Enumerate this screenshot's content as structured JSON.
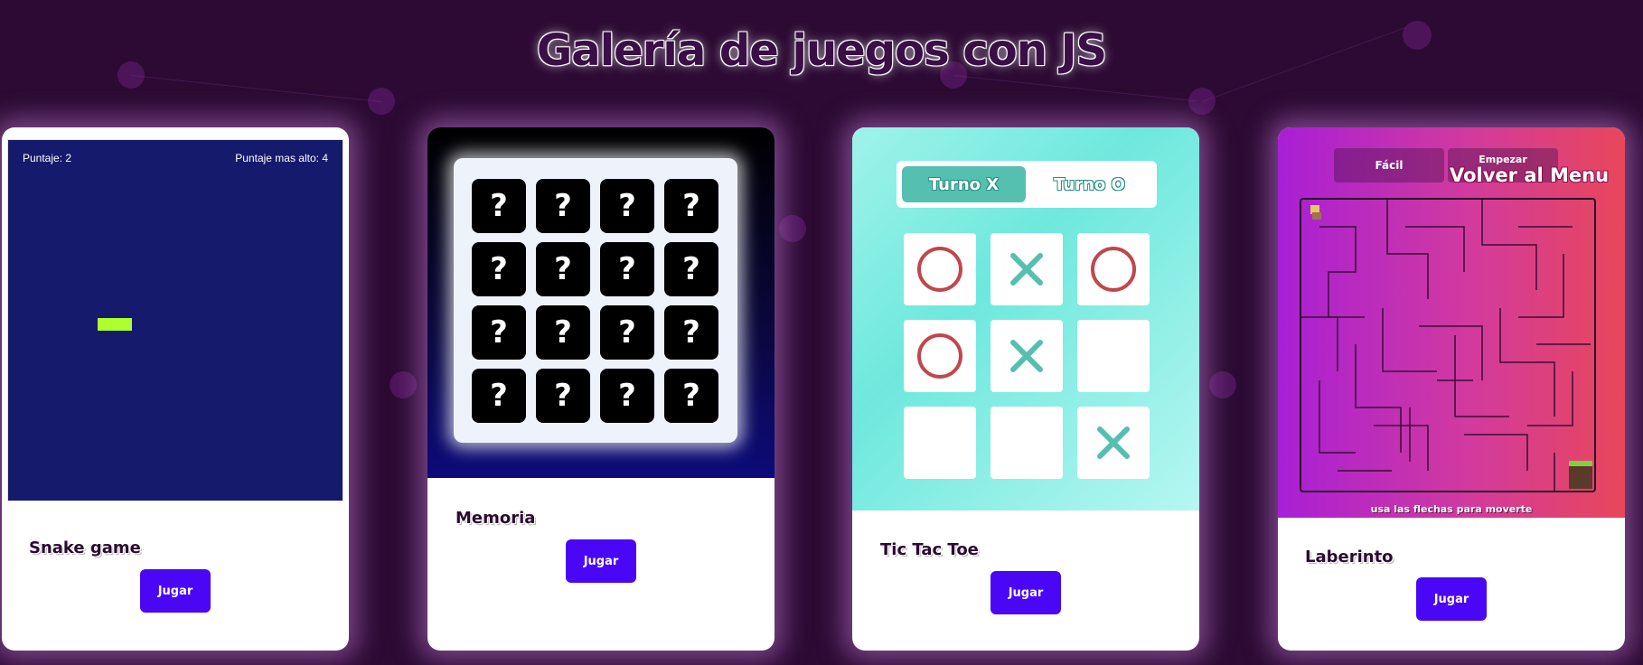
{
  "page": {
    "title": "Galería de juegos con JS"
  },
  "colors": {
    "background": "#2c0a33",
    "play_button": "#4a07f5",
    "snake_board": "#151a6c",
    "snake_body": "#adff2f",
    "ttt_accent": "#55bfb0",
    "ttt_o": "#c0474b"
  },
  "games": [
    {
      "name": "Snake game",
      "button": "Jugar",
      "preview": {
        "score_label": "Puntaje: 2",
        "high_score_label": "Puntaje mas alto: 4"
      }
    },
    {
      "name": "Memoria",
      "button": "Jugar",
      "preview": {
        "tiles": [
          "?",
          "?",
          "?",
          "?",
          "?",
          "?",
          "?",
          "?",
          "?",
          "?",
          "?",
          "?",
          "?",
          "?",
          "?",
          "?"
        ]
      }
    },
    {
      "name": "Tic Tac Toe",
      "button": "Jugar",
      "preview": {
        "turn_x": "Turno X",
        "turn_o": "Turno O",
        "board": [
          "O",
          "X",
          "O",
          "O",
          "X",
          "",
          "",
          "",
          "X"
        ]
      }
    },
    {
      "name": "Laberinto",
      "button": "Jugar",
      "preview": {
        "easy_button": "Fácil",
        "start_button": "Empezar",
        "back_menu": "Volver al Menu",
        "hint": "usa las flechas para moverte"
      }
    }
  ]
}
